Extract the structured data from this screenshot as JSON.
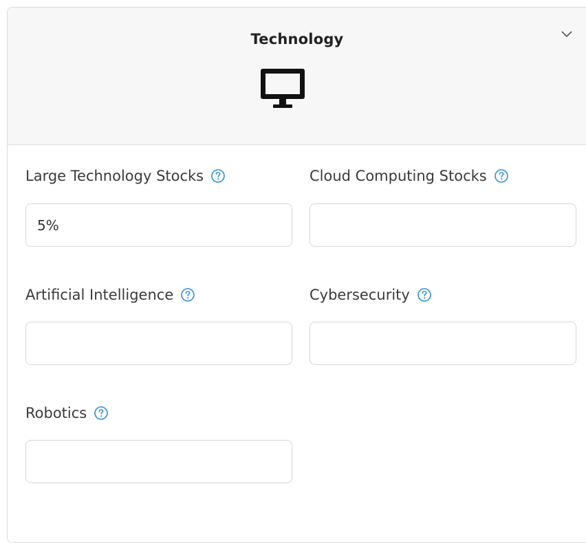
{
  "section": {
    "title": "Technology",
    "icon": "desktop-monitor-icon",
    "toggle_icon": "chevron-down-icon"
  },
  "fields": [
    {
      "label": "Large Technology Stocks",
      "value": "5%",
      "placeholder": ""
    },
    {
      "label": "Cloud Computing Stocks",
      "value": "",
      "placeholder": ""
    },
    {
      "label": "Artificial Intelligence",
      "value": "",
      "placeholder": ""
    },
    {
      "label": "Cybersecurity",
      "value": "",
      "placeholder": ""
    },
    {
      "label": "Robotics",
      "value": "",
      "placeholder": ""
    }
  ],
  "help_icon": "question-circle-icon",
  "colors": {
    "accent": "#2f8fd8",
    "header_bg": "#f7f7f7",
    "border": "#d7d7d7"
  }
}
